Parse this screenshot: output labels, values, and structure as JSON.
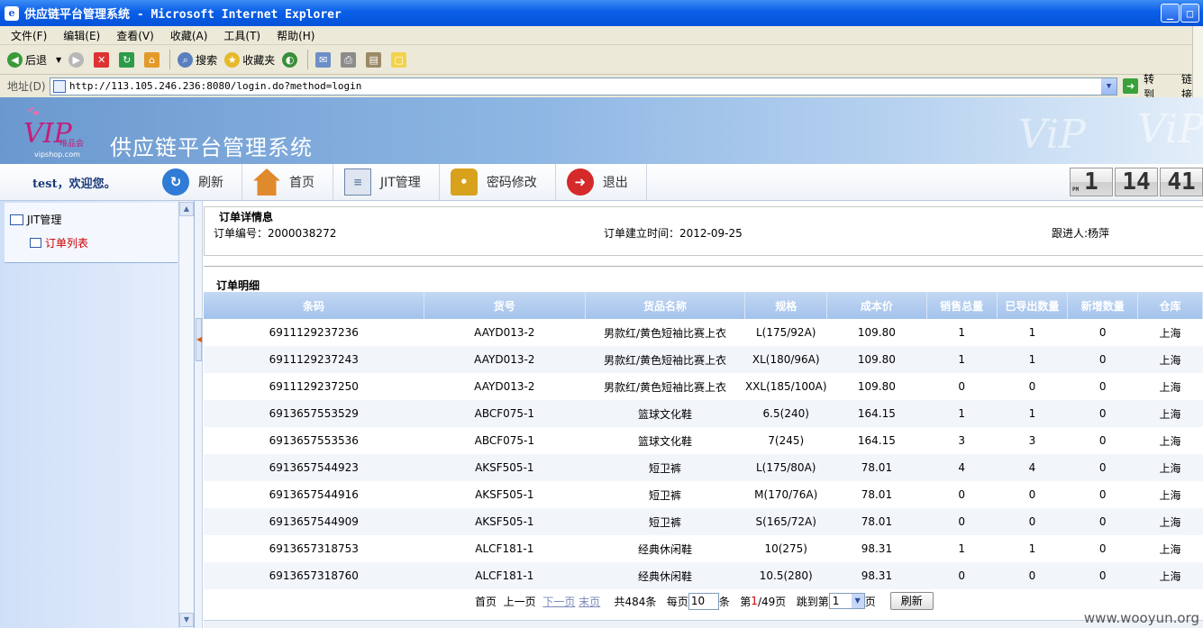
{
  "window": {
    "title": "供应链平台管理系统 - Microsoft Internet Explorer",
    "controls": [
      "_",
      "□",
      "✕"
    ]
  },
  "menu": [
    "文件(F)",
    "编辑(E)",
    "查看(V)",
    "收藏(A)",
    "工具(T)",
    "帮助(H)"
  ],
  "toolbar": {
    "back": "后退",
    "search": "搜索",
    "favorites": "收藏夹"
  },
  "address": {
    "label": "地址(D)",
    "url": "http://113.105.246.236:8080/login.do?method=login",
    "go": "转到",
    "links": "链接"
  },
  "banner": {
    "title": "供应链平台管理系统",
    "logo_text": "VIP",
    "logo_sub": "唯品会",
    "logo_url": "vipshop.com"
  },
  "nav": {
    "welcome": "test，欢迎您。",
    "items": [
      {
        "label": "刷新",
        "icon": "refresh-icon",
        "color": "#2f7bd6"
      },
      {
        "label": "首页",
        "icon": "home-icon",
        "color": "#e08a2e"
      },
      {
        "label": "JIT管理",
        "icon": "document-icon",
        "color": "#6b84a8"
      },
      {
        "label": "密码修改",
        "icon": "lock-icon",
        "color": "#d9a21c"
      },
      {
        "label": "退出",
        "icon": "exit-icon",
        "color": "#d42a2a"
      }
    ]
  },
  "clock": {
    "period": "PM",
    "hour": "1",
    "minute": "14",
    "second": "41"
  },
  "sidebar": {
    "root": "JIT管理",
    "child": "订单列表"
  },
  "order": {
    "section_title": "订单详情息",
    "number": "订单编号：2000038272",
    "created": "订单建立时间：2012-09-25",
    "follower": "跟进人:杨萍"
  },
  "detail": {
    "title": "订单明细",
    "columns": [
      "条码",
      "货号",
      "货品名称",
      "规格",
      "成本价",
      "销售总量",
      "已导出数量",
      "新增数量",
      "仓库"
    ],
    "rows": [
      [
        "6911129237236",
        "AAYD013-2",
        "男款红/黄色短袖比赛上衣",
        "L(175/92A)",
        "109.80",
        "1",
        "1",
        "0",
        "上海"
      ],
      [
        "6911129237243",
        "AAYD013-2",
        "男款红/黄色短袖比赛上衣",
        "XL(180/96A)",
        "109.80",
        "1",
        "1",
        "0",
        "上海"
      ],
      [
        "6911129237250",
        "AAYD013-2",
        "男款红/黄色短袖比赛上衣",
        "XXL(185/100A)",
        "109.80",
        "0",
        "0",
        "0",
        "上海"
      ],
      [
        "6913657553529",
        "ABCF075-1",
        "篮球文化鞋",
        "6.5(240)",
        "164.15",
        "1",
        "1",
        "0",
        "上海"
      ],
      [
        "6913657553536",
        "ABCF075-1",
        "篮球文化鞋",
        "7(245)",
        "164.15",
        "3",
        "3",
        "0",
        "上海"
      ],
      [
        "6913657544923",
        "AKSF505-1",
        "短卫裤",
        "L(175/80A)",
        "78.01",
        "4",
        "4",
        "0",
        "上海"
      ],
      [
        "6913657544916",
        "AKSF505-1",
        "短卫裤",
        "M(170/76A)",
        "78.01",
        "0",
        "0",
        "0",
        "上海"
      ],
      [
        "6913657544909",
        "AKSF505-1",
        "短卫裤",
        "S(165/72A)",
        "78.01",
        "0",
        "0",
        "0",
        "上海"
      ],
      [
        "6913657318753",
        "ALCF181-1",
        "经典休闲鞋",
        "10(275)",
        "98.31",
        "1",
        "1",
        "0",
        "上海"
      ],
      [
        "6913657318760",
        "ALCF181-1",
        "经典休闲鞋",
        "10.5(280)",
        "98.31",
        "0",
        "0",
        "0",
        "上海"
      ]
    ]
  },
  "pager": {
    "first": "首页",
    "prev": "上一页",
    "next": "下一页",
    "last": "末页",
    "total": "共484条",
    "per_page_label": "每页",
    "per_page": "10",
    "per_page_unit": "条",
    "page_prefix": "第",
    "page_current": "1",
    "page_rest": "/49页",
    "jump_label": "跳到第",
    "jump_value": "1",
    "jump_unit": "页",
    "refresh": "刷新"
  },
  "watermark": "www.wooyun.org"
}
